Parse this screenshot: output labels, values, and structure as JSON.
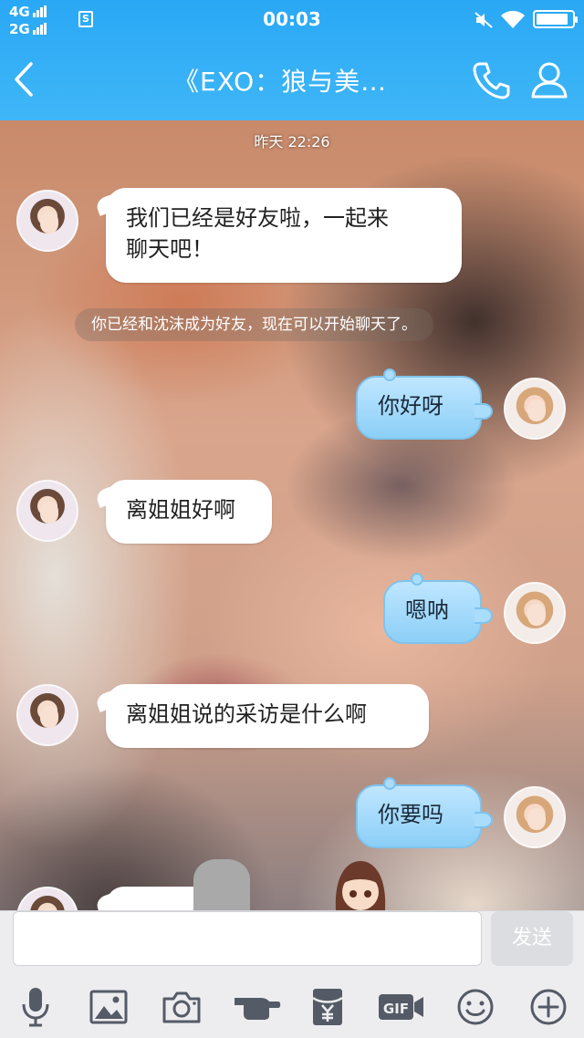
{
  "status_bar": {
    "signal_1": "4G",
    "signal_2": "2G",
    "sim_badge": "S",
    "time": "00:03",
    "battery_level": 0.9
  },
  "header": {
    "title": "《EXO：狼与美…",
    "back_icon": "chevron-left-icon",
    "call_icon": "phone-icon",
    "profile_icon": "person-icon",
    "bg_color": "#2aa8f5"
  },
  "chat": {
    "timestamp": "昨天 22:26",
    "system_message": "你已经和沈沫成为好友，现在可以开始聊天了。",
    "messages": [
      {
        "direction": "in",
        "lines": [
          "我们已经是好友啦，一起来",
          "聊天吧！"
        ]
      },
      {
        "direction": "out",
        "text": "你好呀"
      },
      {
        "direction": "in",
        "text": "离姐姐好啊"
      },
      {
        "direction": "out",
        "text": "嗯呐"
      },
      {
        "direction": "in",
        "text": "离姐姐说的采访是什么啊"
      },
      {
        "direction": "out",
        "text": "你要吗"
      }
    ]
  },
  "composer": {
    "input_value": "",
    "send_label": "发送",
    "gif_label": "GIF",
    "tools": [
      "microphone-icon",
      "image-icon",
      "camera-icon",
      "poke-icon",
      "red-packet-icon",
      "gif-icon",
      "emoji-icon",
      "plus-icon"
    ]
  }
}
